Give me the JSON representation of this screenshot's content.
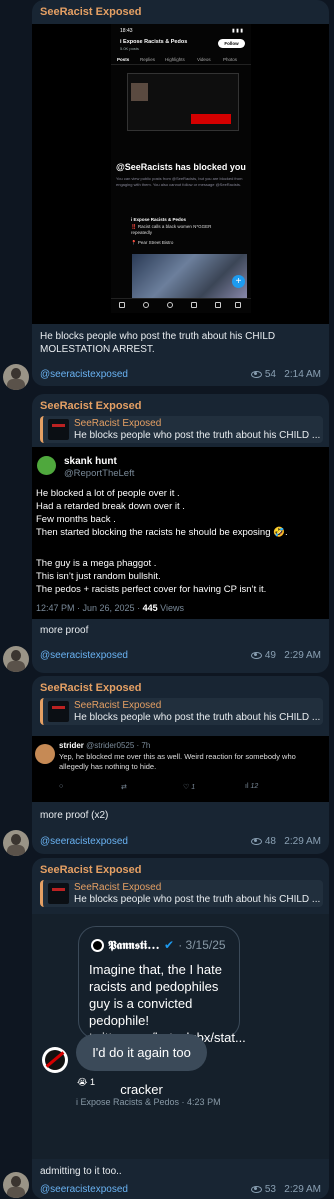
{
  "channel_name": "SeeRacist Exposed",
  "posts": [
    {
      "phone": {
        "time": "18:43",
        "status_right": "▮ ▮ ▮",
        "title": "i Expose Racists & Pedos",
        "subtitle": "5.0K posts",
        "follow": "Follow",
        "tabs": [
          "Posts",
          "Replies",
          "Highlights",
          "Videos",
          "Photos"
        ],
        "blocked_title": "@SeeRacists has blocked you",
        "blocked_sub": "You can view public posts from @SeeRacists, but you are blocked from engaging with them. You also cannot follow or message @SeeRacists.",
        "tweet_name": "i Expose Racists & Pedos",
        "tweet_line1": "‼️ Racist calls a black women N*GGER",
        "tweet_line2": "repeatedly",
        "tweet_line3": "📍 Pear Street Bistro"
      },
      "text": "He blocks people who post the truth about his CHILD MOLESTATION ARREST.",
      "link": "@seeracistexposed",
      "views": "54",
      "time": "2:14 AM"
    },
    {
      "reply_name": "SeeRacist Exposed",
      "reply_text": "He blocks people who post the truth about his CHILD ...",
      "tweet": {
        "name": "skank hunt",
        "handle": "@ReportTheLeft",
        "lines": [
          "He blocked a lot of people over it .",
          "Had a retarded break down over it .",
          "Few months back .",
          "Then started blocking the racists he should be exposing 🤣.",
          "",
          "The guy is a mega phaggot .",
          "This isn’t just random bullshit.",
          "The pedos + racists perfect cover for having CP isn’t it."
        ],
        "meta_time": "12:47 PM · Jun 26, 2025 · ",
        "meta_views": "445",
        "meta_views_label": " Views"
      },
      "text": "more proof",
      "link": "@seeracistexposed",
      "views": "49",
      "time": "2:29 AM"
    },
    {
      "reply_name": "SeeRacist Exposed",
      "reply_text": "He blocks people who post the truth about his CHILD ...",
      "tweet": {
        "name": "strider",
        "handle": "@strider0525 · 7h",
        "body": "Yep, he blocked me over this as well. Weird reaction for somebody who allegedly has nothing to hide.",
        "likes": "1",
        "views": "12"
      },
      "text": "more proof (x2)",
      "link": "@seeracistexposed",
      "views": "48",
      "time": "2:29 AM"
    },
    {
      "reply_name": "SeeRacist Exposed",
      "reply_text": "He blocks people who post the truth about his CHILD ...",
      "dm": {
        "quote_name": "𝕻𝖆𝖓𝖓𝖘𝖙𝖎...",
        "quote_date": "· 3/15/25",
        "quote_text": "Imagine that, the I hate racists and pedophiles guy is a convicted pedophile! twitter.com/hateclubx/stat...",
        "bubble": "I'd do it again too cracker",
        "reaction": "😭 1",
        "footer": "i Expose Racists & Pedos · 4:23 PM"
      },
      "text": "admitting to it too..",
      "link": "@seeracistexposed",
      "views": "53",
      "time": "2:29 AM"
    }
  ]
}
